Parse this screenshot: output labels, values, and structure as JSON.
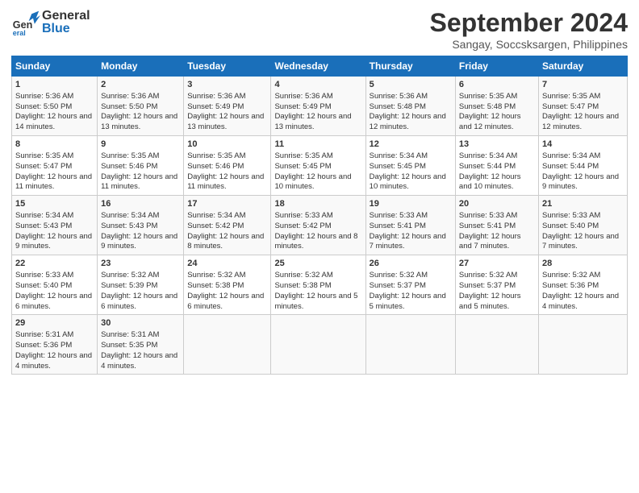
{
  "header": {
    "logo_general": "General",
    "logo_blue": "Blue",
    "title": "September 2024",
    "subtitle": "Sangay, Soccsksargen, Philippines"
  },
  "columns": [
    "Sunday",
    "Monday",
    "Tuesday",
    "Wednesday",
    "Thursday",
    "Friday",
    "Saturday"
  ],
  "weeks": [
    [
      {
        "day": "1",
        "sunrise": "Sunrise: 5:36 AM",
        "sunset": "Sunset: 5:50 PM",
        "daylight": "Daylight: 12 hours and 14 minutes."
      },
      {
        "day": "2",
        "sunrise": "Sunrise: 5:36 AM",
        "sunset": "Sunset: 5:50 PM",
        "daylight": "Daylight: 12 hours and 13 minutes."
      },
      {
        "day": "3",
        "sunrise": "Sunrise: 5:36 AM",
        "sunset": "Sunset: 5:49 PM",
        "daylight": "Daylight: 12 hours and 13 minutes."
      },
      {
        "day": "4",
        "sunrise": "Sunrise: 5:36 AM",
        "sunset": "Sunset: 5:49 PM",
        "daylight": "Daylight: 12 hours and 13 minutes."
      },
      {
        "day": "5",
        "sunrise": "Sunrise: 5:36 AM",
        "sunset": "Sunset: 5:48 PM",
        "daylight": "Daylight: 12 hours and 12 minutes."
      },
      {
        "day": "6",
        "sunrise": "Sunrise: 5:35 AM",
        "sunset": "Sunset: 5:48 PM",
        "daylight": "Daylight: 12 hours and 12 minutes."
      },
      {
        "day": "7",
        "sunrise": "Sunrise: 5:35 AM",
        "sunset": "Sunset: 5:47 PM",
        "daylight": "Daylight: 12 hours and 12 minutes."
      }
    ],
    [
      {
        "day": "8",
        "sunrise": "Sunrise: 5:35 AM",
        "sunset": "Sunset: 5:47 PM",
        "daylight": "Daylight: 12 hours and 11 minutes."
      },
      {
        "day": "9",
        "sunrise": "Sunrise: 5:35 AM",
        "sunset": "Sunset: 5:46 PM",
        "daylight": "Daylight: 12 hours and 11 minutes."
      },
      {
        "day": "10",
        "sunrise": "Sunrise: 5:35 AM",
        "sunset": "Sunset: 5:46 PM",
        "daylight": "Daylight: 12 hours and 11 minutes."
      },
      {
        "day": "11",
        "sunrise": "Sunrise: 5:35 AM",
        "sunset": "Sunset: 5:45 PM",
        "daylight": "Daylight: 12 hours and 10 minutes."
      },
      {
        "day": "12",
        "sunrise": "Sunrise: 5:34 AM",
        "sunset": "Sunset: 5:45 PM",
        "daylight": "Daylight: 12 hours and 10 minutes."
      },
      {
        "day": "13",
        "sunrise": "Sunrise: 5:34 AM",
        "sunset": "Sunset: 5:44 PM",
        "daylight": "Daylight: 12 hours and 10 minutes."
      },
      {
        "day": "14",
        "sunrise": "Sunrise: 5:34 AM",
        "sunset": "Sunset: 5:44 PM",
        "daylight": "Daylight: 12 hours and 9 minutes."
      }
    ],
    [
      {
        "day": "15",
        "sunrise": "Sunrise: 5:34 AM",
        "sunset": "Sunset: 5:43 PM",
        "daylight": "Daylight: 12 hours and 9 minutes."
      },
      {
        "day": "16",
        "sunrise": "Sunrise: 5:34 AM",
        "sunset": "Sunset: 5:43 PM",
        "daylight": "Daylight: 12 hours and 9 minutes."
      },
      {
        "day": "17",
        "sunrise": "Sunrise: 5:34 AM",
        "sunset": "Sunset: 5:42 PM",
        "daylight": "Daylight: 12 hours and 8 minutes."
      },
      {
        "day": "18",
        "sunrise": "Sunrise: 5:33 AM",
        "sunset": "Sunset: 5:42 PM",
        "daylight": "Daylight: 12 hours and 8 minutes."
      },
      {
        "day": "19",
        "sunrise": "Sunrise: 5:33 AM",
        "sunset": "Sunset: 5:41 PM",
        "daylight": "Daylight: 12 hours and 7 minutes."
      },
      {
        "day": "20",
        "sunrise": "Sunrise: 5:33 AM",
        "sunset": "Sunset: 5:41 PM",
        "daylight": "Daylight: 12 hours and 7 minutes."
      },
      {
        "day": "21",
        "sunrise": "Sunrise: 5:33 AM",
        "sunset": "Sunset: 5:40 PM",
        "daylight": "Daylight: 12 hours and 7 minutes."
      }
    ],
    [
      {
        "day": "22",
        "sunrise": "Sunrise: 5:33 AM",
        "sunset": "Sunset: 5:40 PM",
        "daylight": "Daylight: 12 hours and 6 minutes."
      },
      {
        "day": "23",
        "sunrise": "Sunrise: 5:32 AM",
        "sunset": "Sunset: 5:39 PM",
        "daylight": "Daylight: 12 hours and 6 minutes."
      },
      {
        "day": "24",
        "sunrise": "Sunrise: 5:32 AM",
        "sunset": "Sunset: 5:38 PM",
        "daylight": "Daylight: 12 hours and 6 minutes."
      },
      {
        "day": "25",
        "sunrise": "Sunrise: 5:32 AM",
        "sunset": "Sunset: 5:38 PM",
        "daylight": "Daylight: 12 hours and 5 minutes."
      },
      {
        "day": "26",
        "sunrise": "Sunrise: 5:32 AM",
        "sunset": "Sunset: 5:37 PM",
        "daylight": "Daylight: 12 hours and 5 minutes."
      },
      {
        "day": "27",
        "sunrise": "Sunrise: 5:32 AM",
        "sunset": "Sunset: 5:37 PM",
        "daylight": "Daylight: 12 hours and 5 minutes."
      },
      {
        "day": "28",
        "sunrise": "Sunrise: 5:32 AM",
        "sunset": "Sunset: 5:36 PM",
        "daylight": "Daylight: 12 hours and 4 minutes."
      }
    ],
    [
      {
        "day": "29",
        "sunrise": "Sunrise: 5:31 AM",
        "sunset": "Sunset: 5:36 PM",
        "daylight": "Daylight: 12 hours and 4 minutes."
      },
      {
        "day": "30",
        "sunrise": "Sunrise: 5:31 AM",
        "sunset": "Sunset: 5:35 PM",
        "daylight": "Daylight: 12 hours and 4 minutes."
      },
      null,
      null,
      null,
      null,
      null
    ]
  ]
}
